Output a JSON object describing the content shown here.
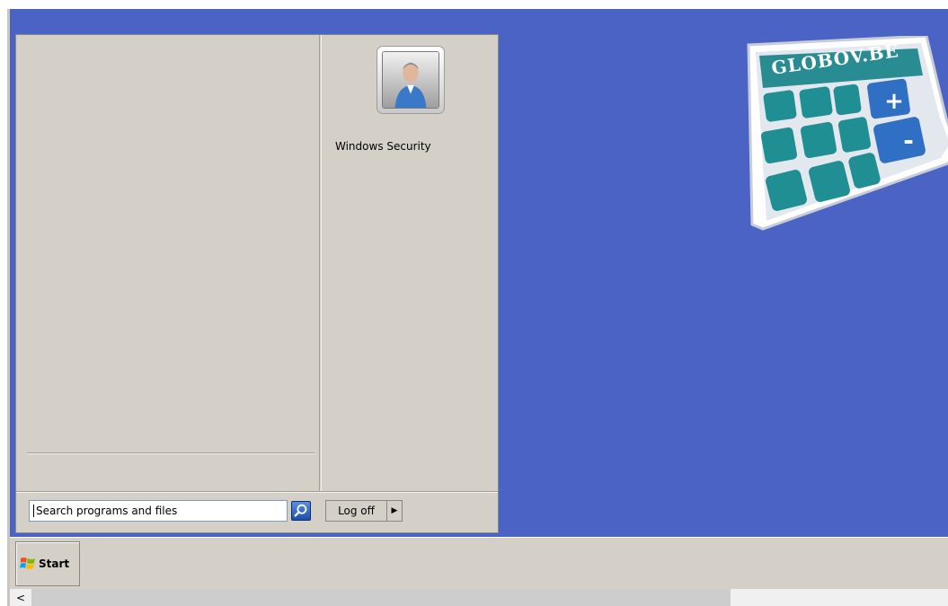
{
  "desktop": {
    "background_color": "#4b63c5",
    "logo": {
      "text": "GLOBOV.BE",
      "plus_symbol": "+",
      "minus_symbol": "-",
      "accent_teal": "#1f8f93",
      "accent_blue": "#2f6fc4"
    }
  },
  "start_menu": {
    "right_pane": {
      "user_picture_icon": "user-avatar-icon",
      "items": [
        {
          "label": "Windows Security"
        }
      ]
    },
    "search": {
      "placeholder": "Search programs and files",
      "button_icon": "search-icon"
    },
    "logoff": {
      "label": "Log off",
      "arrow": "▶"
    }
  },
  "taskbar": {
    "start_label": "Start",
    "start_icon": "windows-flag-icon"
  },
  "scrollbar": {
    "left_arrow": "<"
  }
}
